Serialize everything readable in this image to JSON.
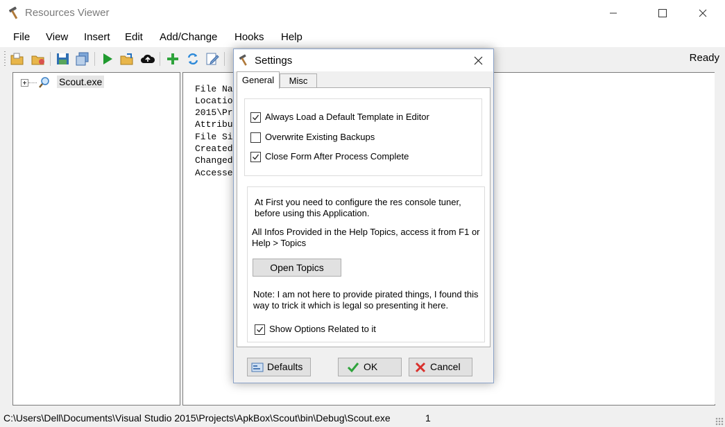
{
  "window": {
    "title": "Resources Viewer",
    "icon": "hammer-icon",
    "controls": [
      "minimize-icon",
      "maximize-icon",
      "close-icon"
    ]
  },
  "menu": [
    "File",
    "View",
    "Insert",
    "Edit",
    "Add/Change",
    "Hooks",
    "Help"
  ],
  "toolbar": {
    "buttons": [
      "open-folder-icon",
      "open-file-icon",
      "save-icon",
      "save-as-icon",
      "run-icon",
      "export-folder-icon",
      "upload-cloud-icon",
      "add-icon",
      "refresh-icon",
      "edit-icon"
    ],
    "status": "Ready"
  },
  "tree": {
    "items": [
      {
        "label": "Scout.exe",
        "icon": "magnifier-icon"
      }
    ]
  },
  "details": {
    "lines": [
      "File Na",
      "Locatio",
      "2015\\Pr",
      "Attribu",
      "File Si",
      "Created",
      "Changed",
      "Accesse"
    ]
  },
  "statusbar": {
    "path": "C:\\Users\\Dell\\Documents\\Visual Studio 2015\\Projects\\ApkBox\\Scout\\bin\\Debug\\Scout.exe",
    "count": "1"
  },
  "dialog": {
    "title": "Settings",
    "icon": "hammer-icon",
    "tabs": [
      "General",
      "Misc"
    ],
    "active_tab": "General",
    "options": [
      {
        "label": "Always Load a Default Template in Editor",
        "checked": true
      },
      {
        "label": "Overwrite Existing Backups",
        "checked": false
      },
      {
        "label": "Close Form After Process Complete",
        "checked": true
      }
    ],
    "info1": "At First you need to configure the res console tuner, before using this Application.",
    "info2": "All Infos Provided in the Help Topics, access it from F1 or Help > Topics",
    "open_topics": "Open Topics",
    "note": "Note: I am not here to provide pirated things, I found this way to trick it which is legal so presenting it here.",
    "show_options": {
      "label": "Show Options Related to it",
      "checked": true
    },
    "buttons": {
      "defaults": "Defaults",
      "ok": "OK",
      "cancel": "Cancel"
    }
  }
}
